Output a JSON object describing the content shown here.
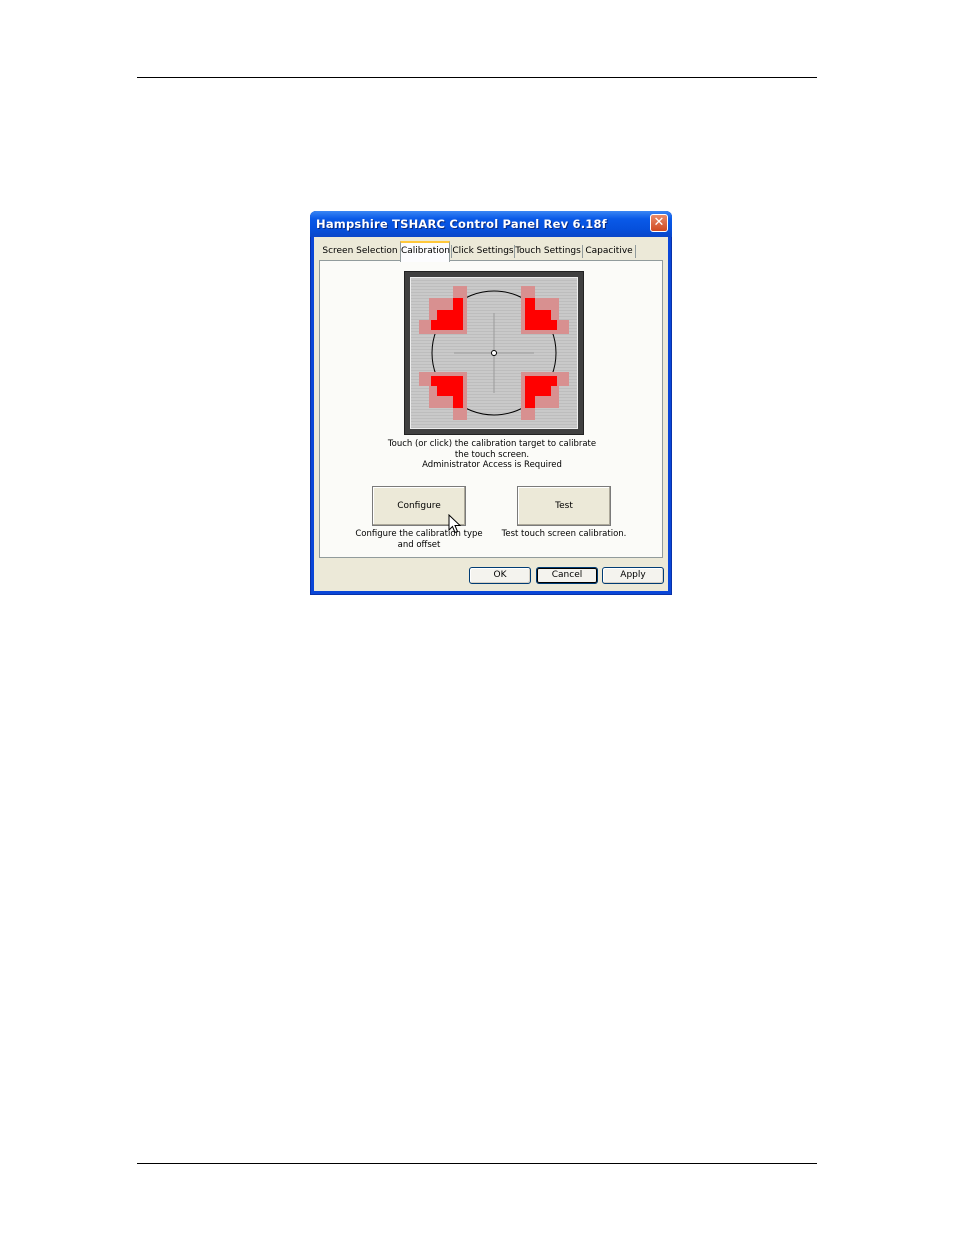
{
  "window": {
    "title": "Hampshire TSHARC Control Panel Rev 6.18f",
    "close_label": "✕"
  },
  "tabs": [
    {
      "label": "Screen Selection",
      "active": false
    },
    {
      "label": "Calibration",
      "active": true
    },
    {
      "label": "Click Settings",
      "active": false
    },
    {
      "label": "Touch Settings",
      "active": false
    },
    {
      "label": "Capacitive",
      "active": false
    }
  ],
  "calibration": {
    "instruction_line1": "Touch (or click) the calibration target to calibrate",
    "instruction_line2": "the touch screen.",
    "instruction_line3": "Administrator Access is Required",
    "configure_button": "Configure",
    "configure_desc_line1": "Configure the calibration type",
    "configure_desc_line2": "and offset",
    "test_button": "Test",
    "test_desc": "Test touch screen calibration."
  },
  "footer": {
    "ok": "OK",
    "cancel": "Cancel",
    "apply": "Apply"
  },
  "colors": {
    "arrow_red": "#ff0000",
    "arrow_pink": "#d89090",
    "title_blue": "#0a5ae8"
  }
}
